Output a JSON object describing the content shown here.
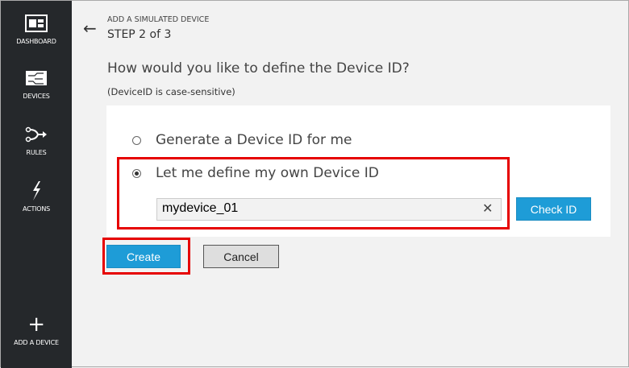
{
  "sidebar": {
    "items": [
      {
        "label": "DASHBOARD",
        "icon": "dashboard-icon"
      },
      {
        "label": "DEVICES",
        "icon": "devices-icon"
      },
      {
        "label": "RULES",
        "icon": "rules-icon"
      },
      {
        "label": "ACTIONS",
        "icon": "lightning-icon"
      }
    ],
    "add_label": "ADD A DEVICE"
  },
  "header": {
    "subtitle": "ADD A SIMULATED DEVICE",
    "step": "STEP 2 of 3"
  },
  "question": "How would you like to define the Device ID?",
  "note": "(DeviceID is case-sensitive)",
  "options": [
    {
      "label": "Generate a Device ID for me",
      "selected": false
    },
    {
      "label": "Let me define my own Device ID",
      "selected": true
    }
  ],
  "device_id_value": "mydevice_01",
  "buttons": {
    "check": "Check ID",
    "create": "Create",
    "cancel": "Cancel"
  },
  "colors": {
    "accent": "#1e9cd7",
    "highlight": "#e60000",
    "sidebar": "#25282b"
  }
}
